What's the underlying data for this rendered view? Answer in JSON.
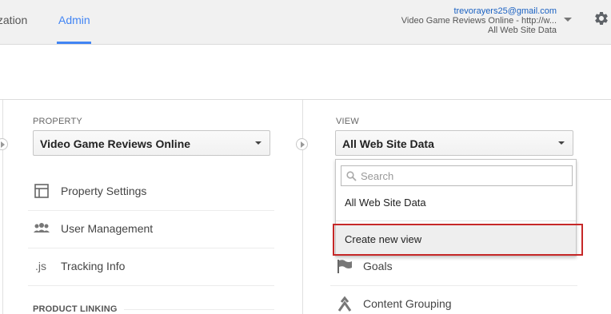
{
  "header": {
    "tabs": [
      {
        "label": "nization",
        "active": false
      },
      {
        "label": "Admin",
        "active": true
      }
    ],
    "account": {
      "email": "trevorayers25@gmail.com",
      "property_line": "Video Game Reviews Online - http://w...",
      "view_line": "All Web Site Data"
    },
    "icons": {
      "account_caret": "chevron-down-icon",
      "settings": "gear-icon"
    }
  },
  "property_column": {
    "label": "PROPERTY",
    "selected": "Video Game Reviews Online",
    "items": [
      {
        "label": "Property Settings",
        "icon": "layout-icon"
      },
      {
        "label": "User Management",
        "icon": "users-icon"
      },
      {
        "label": "Tracking Info",
        "icon": "js-icon"
      }
    ],
    "section_heading": "PRODUCT LINKING"
  },
  "view_column": {
    "label": "VIEW",
    "selected": "All Web Site Data",
    "dropdown": {
      "search_placeholder": "Search",
      "options": [
        "All Web Site Data"
      ],
      "action": "Create new view"
    },
    "items": [
      {
        "label": "Goals",
        "icon": "flag-icon"
      },
      {
        "label": "Content Grouping",
        "icon": "grouping-icon"
      }
    ]
  },
  "colors": {
    "accent": "#4285f4",
    "highlight_border": "#c62828",
    "topbar_bg": "#f1f1f1"
  }
}
